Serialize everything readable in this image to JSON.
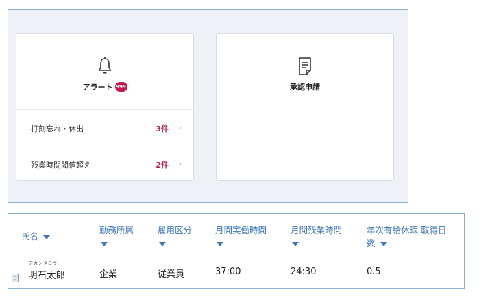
{
  "alert_card": {
    "title": "アラート",
    "badge": "999",
    "items": [
      {
        "label": "打刻忘れ・休出",
        "count": "3件",
        "chevron": "›"
      },
      {
        "label": "残業時間閾値超え",
        "count": "2件",
        "chevron": "›"
      }
    ]
  },
  "approval_card": {
    "title": "承認申請"
  },
  "table": {
    "headers": {
      "name": "氏名",
      "department": "勤務所属",
      "employment_type": "雇用区分",
      "monthly_actual_hours": "月間実働時間",
      "monthly_overtime_hours": "月間残業時間",
      "paid_leave_line1": "年次有給休暇 取得日",
      "paid_leave_line2": "数"
    },
    "rows": [
      {
        "name_reading": "アカシタロウ",
        "name": "明石太郎",
        "department": "企業",
        "employment_type": "従業員",
        "monthly_actual_hours": "37:00",
        "monthly_overtime_hours": "24:30",
        "paid_leave_days": "0.5"
      }
    ]
  },
  "icons": {
    "alert": "bell-icon",
    "approval": "document-icon",
    "sort": "caret-down-icon",
    "memo": "memo-icon"
  },
  "colors": {
    "accent_blue": "#3e77b8",
    "alert_red": "#c8174f",
    "panel_bg": "#eef2f6",
    "border_blue": "#8aaed0"
  }
}
